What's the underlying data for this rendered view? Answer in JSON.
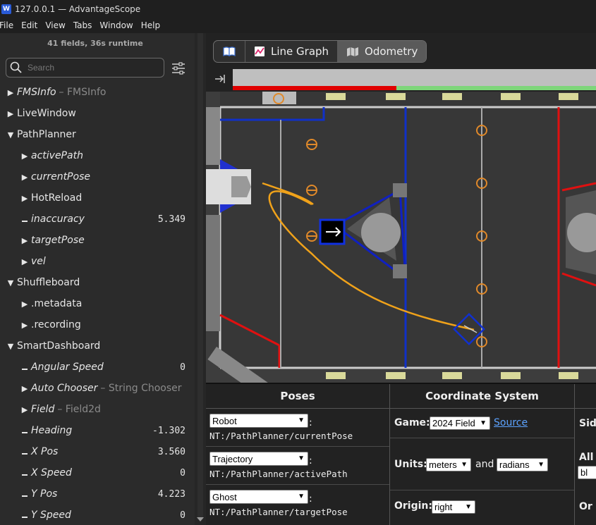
{
  "window": {
    "title": "127.0.0.1 — AdvantageScope"
  },
  "menu": [
    "File",
    "Edit",
    "View",
    "Tabs",
    "Window",
    "Help"
  ],
  "sidebar": {
    "runtime": "41 fields, 36s runtime",
    "search_placeholder": "Search",
    "tree": [
      {
        "label": "FMSInfo",
        "type": "– FMSInfo",
        "arrow": "right",
        "level": 0,
        "italic": true
      },
      {
        "label": "LiveWindow",
        "arrow": "right",
        "level": 0,
        "italic": false
      },
      {
        "label": "PathPlanner",
        "arrow": "down",
        "level": 0,
        "italic": false
      },
      {
        "label": "activePath",
        "arrow": "right",
        "level": 1,
        "italic": true
      },
      {
        "label": "currentPose",
        "arrow": "right",
        "level": 1,
        "italic": true
      },
      {
        "label": "HotReload",
        "arrow": "right",
        "level": 1,
        "italic": false
      },
      {
        "label": "inaccuracy",
        "arrow": "dash",
        "level": 1,
        "italic": true,
        "value": "5.349"
      },
      {
        "label": "targetPose",
        "arrow": "right",
        "level": 1,
        "italic": true
      },
      {
        "label": "vel",
        "arrow": "right",
        "level": 1,
        "italic": true
      },
      {
        "label": "Shuffleboard",
        "arrow": "down",
        "level": 0,
        "italic": false
      },
      {
        "label": ".metadata",
        "arrow": "right",
        "level": 1,
        "italic": false
      },
      {
        "label": ".recording",
        "arrow": "right",
        "level": 1,
        "italic": false
      },
      {
        "label": "SmartDashboard",
        "arrow": "down",
        "level": 0,
        "italic": false
      },
      {
        "label": "Angular Speed",
        "arrow": "dash",
        "level": 1,
        "italic": true,
        "value": "0"
      },
      {
        "label": "Auto Chooser",
        "type": "– String Chooser",
        "arrow": "right",
        "level": 1,
        "italic": true
      },
      {
        "label": "Field",
        "type": "– Field2d",
        "arrow": "right",
        "level": 1,
        "italic": true
      },
      {
        "label": "Heading",
        "arrow": "dash",
        "level": 1,
        "italic": true,
        "value": "-1.302"
      },
      {
        "label": "X Pos",
        "arrow": "dash",
        "level": 1,
        "italic": true,
        "value": "3.560"
      },
      {
        "label": "X Speed",
        "arrow": "dash",
        "level": 1,
        "italic": true,
        "value": "0"
      },
      {
        "label": "Y Pos",
        "arrow": "dash",
        "level": 1,
        "italic": true,
        "value": "4.223"
      },
      {
        "label": "Y Speed",
        "arrow": "dash",
        "level": 1,
        "italic": true,
        "value": "0"
      }
    ]
  },
  "tabs": [
    {
      "icon": "book-icon",
      "label": "",
      "active": false
    },
    {
      "icon": "line-graph-icon",
      "label": "Line Graph",
      "active": false
    },
    {
      "icon": "odometry-icon",
      "label": "Odometry",
      "active": true
    }
  ],
  "timeline": {
    "enabled_fraction": 0.45
  },
  "poses": {
    "header": "Poses",
    "rows": [
      {
        "type": "Robot",
        "colon": ":",
        "path": "NT:/PathPlanner/currentPose"
      },
      {
        "type": "Trajectory",
        "colon": ":",
        "path": "NT:/PathPlanner/activePath"
      },
      {
        "type": "Ghost",
        "colon": ":",
        "path": "NT:/PathPlanner/targetPose"
      }
    ]
  },
  "coordinate_system": {
    "header": "Coordinate System",
    "game_label": "Game:",
    "game_value": "2024 Field",
    "source_link": "Source",
    "units_label": "Units:",
    "units_distance": "meters",
    "units_and": "and",
    "units_angle": "radians",
    "origin_label": "Origin:",
    "origin_value": "right"
  },
  "right_col": {
    "side_label": "Sid",
    "alliance_label": "All",
    "alliance_value": "bl",
    "orientation_label": "Or"
  }
}
